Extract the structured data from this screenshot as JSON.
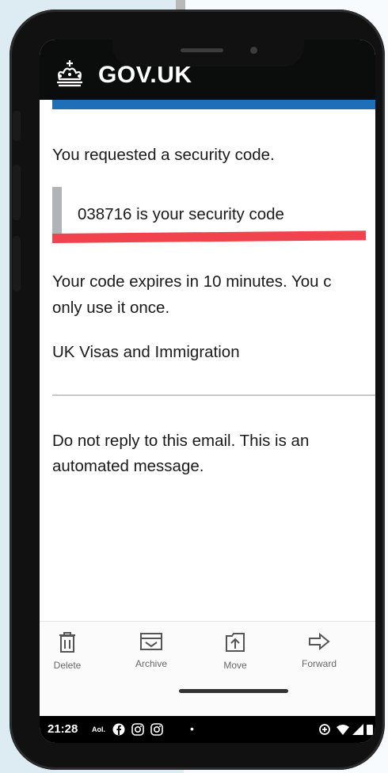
{
  "header": {
    "brand": "GOV.UK"
  },
  "email": {
    "intro": "You requested a security code.",
    "code_line": "038716 is your security code",
    "expiry": "Your code expires in 10 minutes. You c only use it once.",
    "expiry_line1": "Your code expires in 10 minutes. You c",
    "expiry_line2": "only use it once.",
    "sender": "UK Visas and Immigration",
    "footer_line1": "Do not reply to this email. This is an",
    "footer_line2": "automated message."
  },
  "toolbar": {
    "items": [
      {
        "label": "Delete",
        "icon": "trash-icon"
      },
      {
        "label": "Archive",
        "icon": "archive-icon"
      },
      {
        "label": "Move",
        "icon": "move-icon"
      },
      {
        "label": "Forward",
        "icon": "forward-arrow-icon"
      }
    ]
  },
  "status_bar": {
    "time": "21:28",
    "aol": "Aol."
  },
  "colors": {
    "header_bg": "#0b0c0c",
    "gov_blue": "#1d70b8",
    "highlight_red": "#f0434d",
    "inset_bar": "#b1b4b6"
  }
}
